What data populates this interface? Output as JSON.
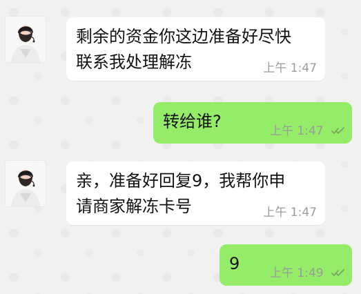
{
  "chat": {
    "messages": [
      {
        "direction": "incoming",
        "text": "剩余的资金你这边准备好尽快\n联系我处理解冻",
        "time": "上午 1:47"
      },
      {
        "direction": "outgoing",
        "text": "转给谁?",
        "time": "上午 1:47",
        "status": "read"
      },
      {
        "direction": "incoming",
        "text": "亲，准备好回复9，我帮你申\n请商家解冻卡号",
        "time": "上午 1:47"
      },
      {
        "direction": "outgoing",
        "text": "9",
        "time": "上午 1:49",
        "status": "read"
      }
    ]
  },
  "colors": {
    "background": "#f1f1f1",
    "incoming_bubble": "#ffffff",
    "outgoing_bubble": "#95ec69",
    "timestamp": "#9b9b9b"
  },
  "icons": {
    "avatar": "customer-service-avatar-icon",
    "read_receipt": "double-check-icon"
  }
}
